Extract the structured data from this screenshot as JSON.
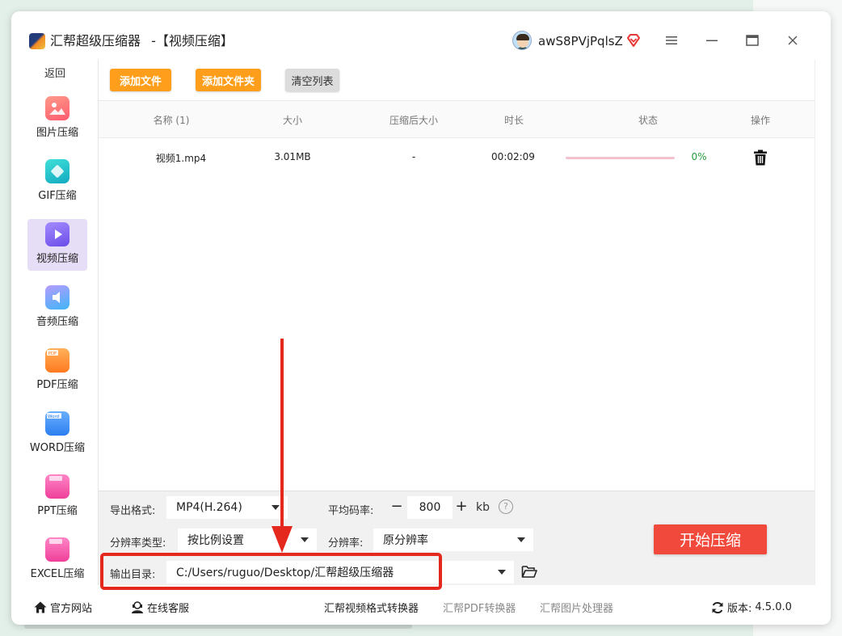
{
  "window": {
    "app_name": "汇帮超级压缩器",
    "title_suffix": "-【视频压缩】",
    "username": "awS8PVjPqlsZ"
  },
  "sidebar": {
    "back_label": "返回",
    "items": [
      {
        "label": "图片压缩",
        "icon": "image-icon",
        "color": "#ff6b6b"
      },
      {
        "label": "GIF压缩",
        "icon": "gif-icon",
        "color": "#22c3c3"
      },
      {
        "label": "视频压缩",
        "icon": "video-icon",
        "color": "#8b6cf0",
        "active": true
      },
      {
        "label": "音频压缩",
        "icon": "audio-icon",
        "color": "#4fa3f7"
      },
      {
        "label": "PDF压缩",
        "icon": "pdf-icon",
        "color": "#ff8a2a"
      },
      {
        "label": "WORD压缩",
        "icon": "word-icon",
        "color": "#3d8ef0"
      },
      {
        "label": "PPT压缩",
        "icon": "ppt-icon",
        "color": "#f35aa6"
      },
      {
        "label": "EXCEL压缩",
        "icon": "excel-icon",
        "color": "#f35aa6"
      }
    ]
  },
  "toolbar": {
    "add_file": "添加文件",
    "add_folder": "添加文件夹",
    "clear_list": "清空列表"
  },
  "table": {
    "headers": {
      "name": "名称 (1)",
      "size": "大小",
      "compressed_size": "压缩后大小",
      "duration": "时长",
      "status": "状态",
      "action": "操作"
    },
    "rows": [
      {
        "name": "视频1.mp4",
        "size": "3.01MB",
        "compressed_size": "-",
        "duration": "00:02:09",
        "progress_percent": 0,
        "progress_label": "0%"
      }
    ]
  },
  "settings": {
    "format_label": "导出格式:",
    "format_value": "MP4(H.264)",
    "bitrate_label": "平均码率:",
    "bitrate_minus": "−",
    "bitrate_value": "800",
    "bitrate_plus": "+",
    "bitrate_unit": "kb",
    "help_glyph": "?",
    "resolution_type_label": "分辨率类型:",
    "resolution_type_value": "按比例设置",
    "resolution_label": "分辨率:",
    "resolution_value": "原分辨率",
    "output_dir_label": "输出目录:",
    "output_dir_value": "C:/Users/ruguo/Desktop/汇帮超级压缩器",
    "start_button": "开始压缩"
  },
  "footer": {
    "website": "官方网站",
    "support": "在线客服",
    "links": [
      "汇帮视频格式转换器",
      "汇帮PDF转换器",
      "汇帮图片处理器"
    ],
    "version_label": "版本:",
    "version_value": "4.5.0.0"
  },
  "colors": {
    "accent_orange": "#ff9e1b",
    "start_red": "#f14a3c",
    "highlight_red": "#e5281e",
    "progress_pink": "#f2c2cf",
    "percent_green": "#2a9d3a",
    "active_nav": "#e6ddf6"
  }
}
